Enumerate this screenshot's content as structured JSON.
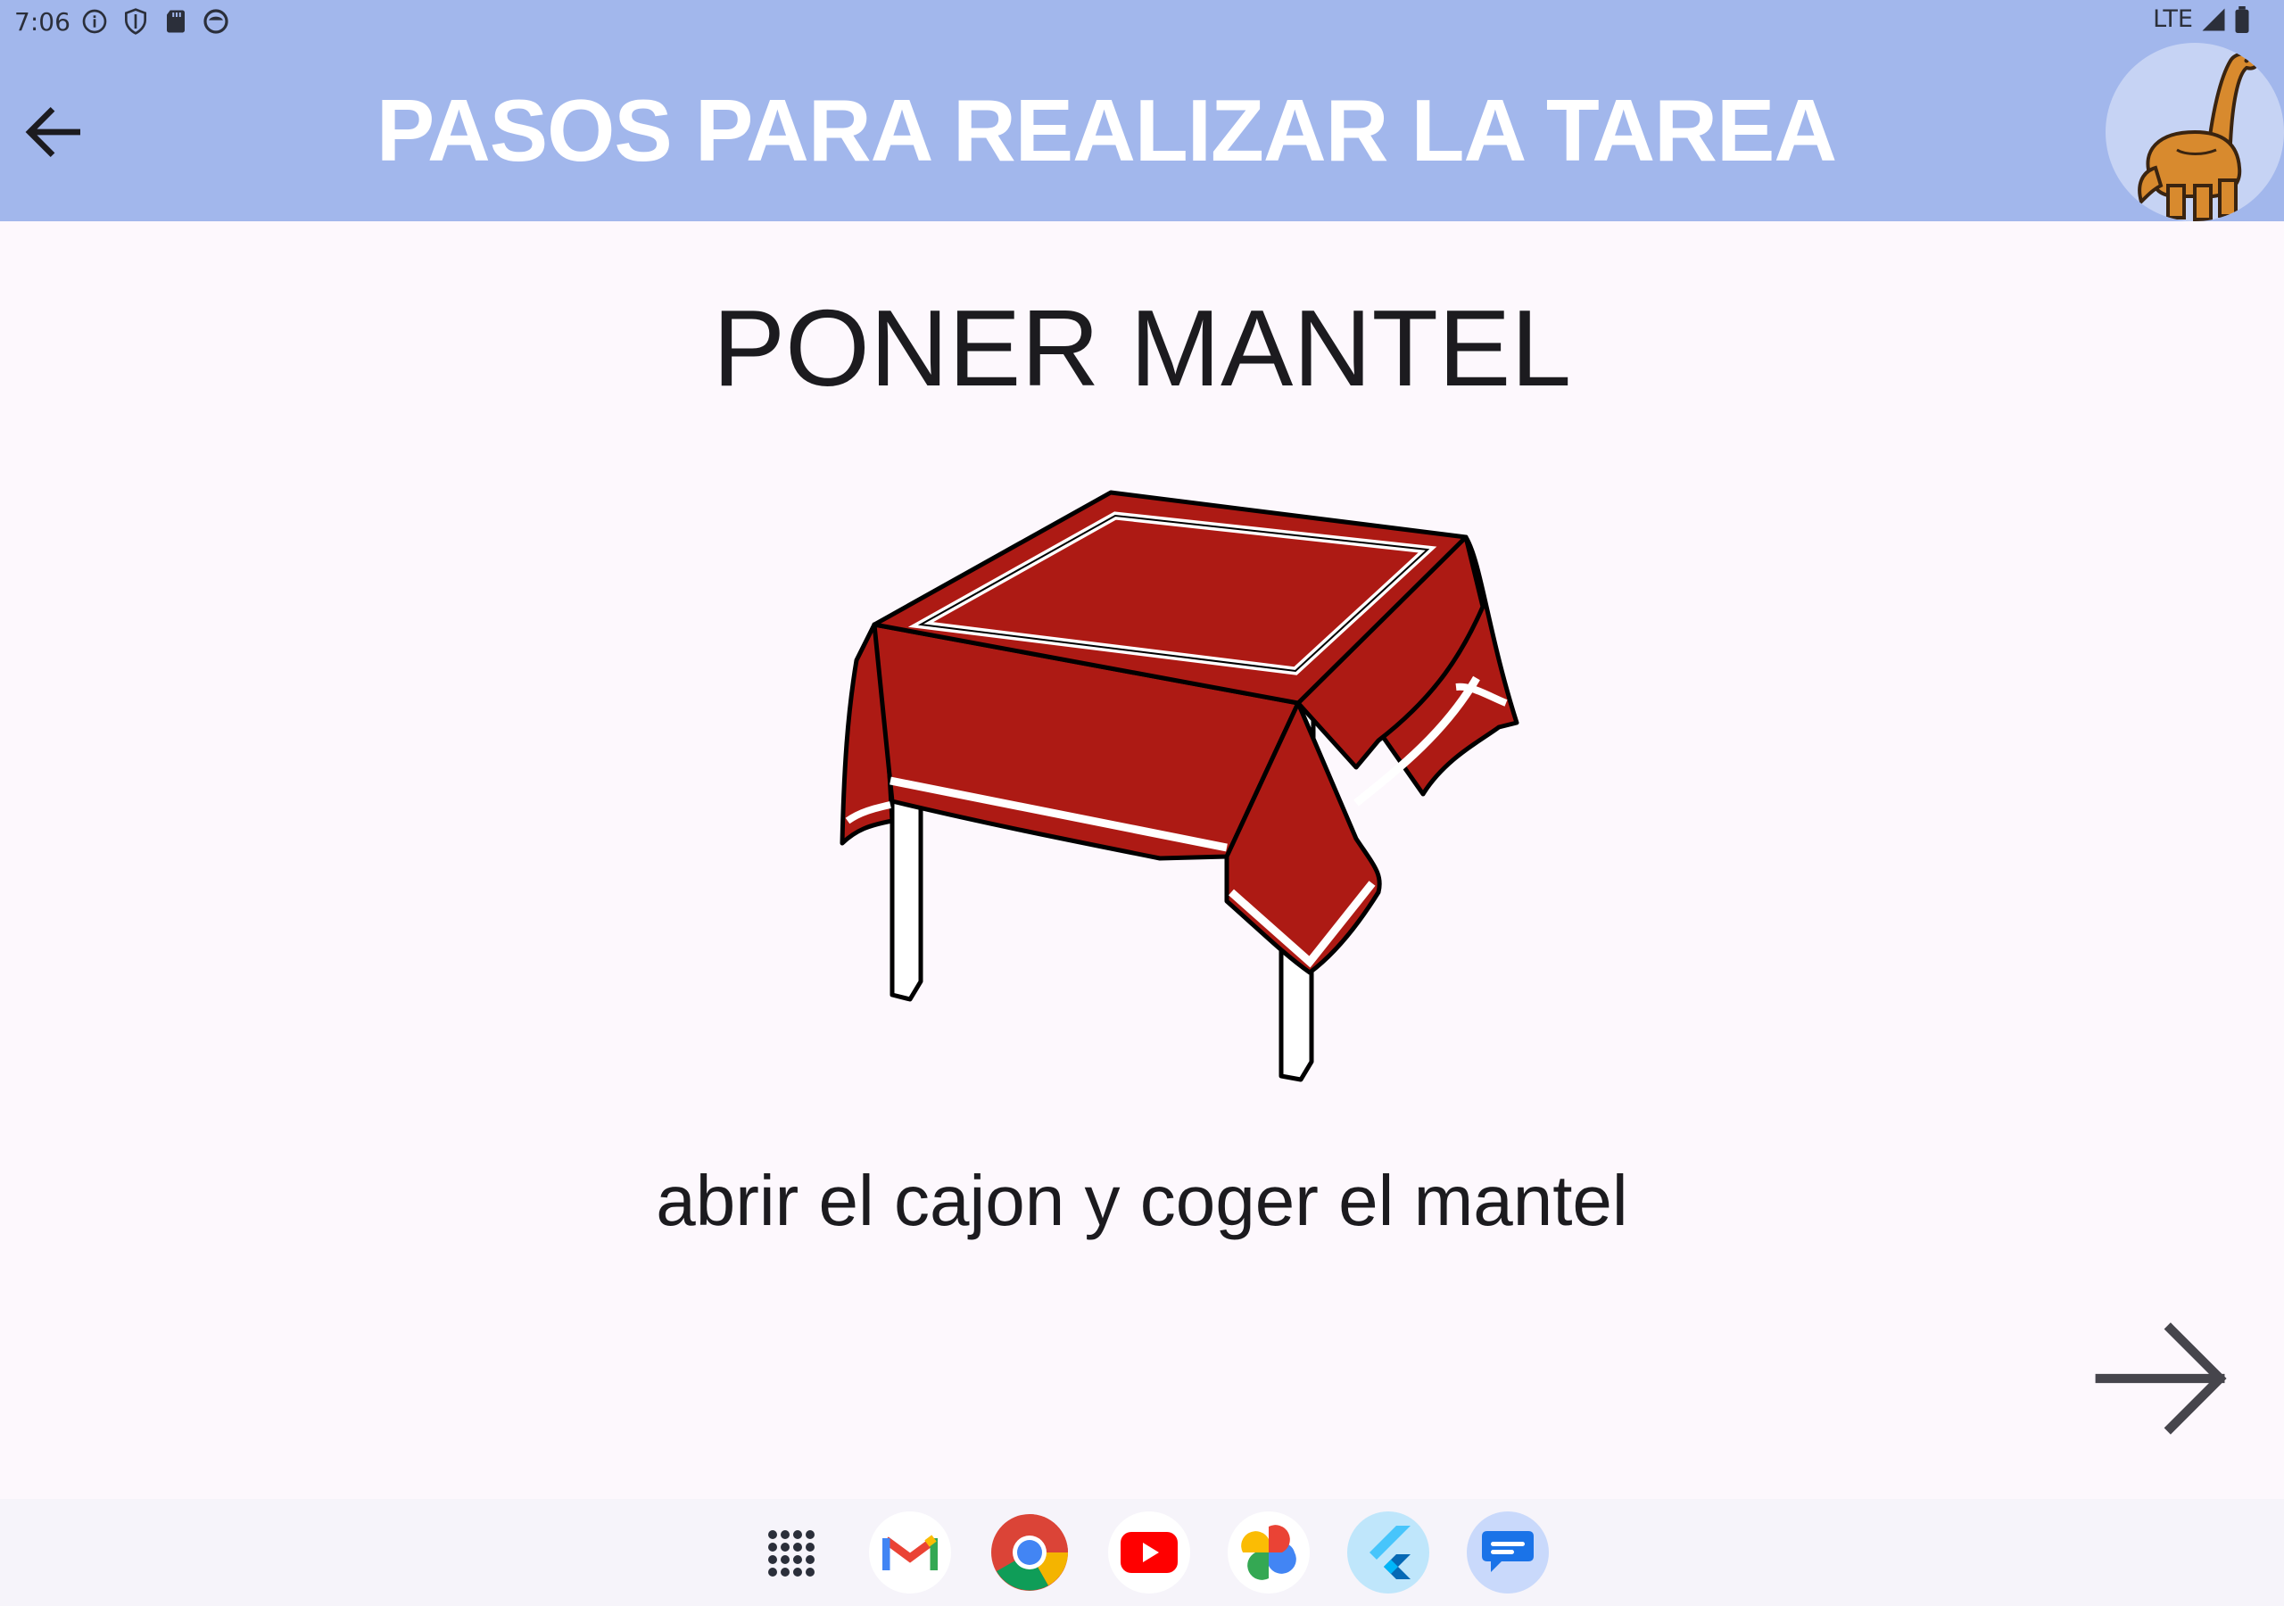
{
  "status_bar": {
    "time": "7:06",
    "network": "LTE",
    "icons": [
      "info-icon",
      "shield-icon",
      "sd-card-icon",
      "face-icon",
      "signal-icon",
      "battery-icon"
    ]
  },
  "app_bar": {
    "title": "PASOS PARA REALIZAR LA TAREA",
    "back_icon": "arrow-back-icon",
    "avatar_icon": "dinosaur-icon",
    "background_color": "#a2b7ec"
  },
  "task": {
    "title": "PONER MANTEL",
    "image_icon": "table-with-tablecloth-illustration",
    "description": "abrir el cajon y coger el mantel"
  },
  "navigation": {
    "next_icon": "arrow-forward-icon"
  },
  "taskbar": {
    "apps": [
      "app-drawer-icon",
      "gmail-icon",
      "chrome-icon",
      "youtube-icon",
      "photos-icon",
      "flutter-icon",
      "messages-icon"
    ]
  },
  "colors": {
    "tablecloth": "#ad1a14",
    "text": "#1c1b1f",
    "background": "#fdf8fd"
  }
}
